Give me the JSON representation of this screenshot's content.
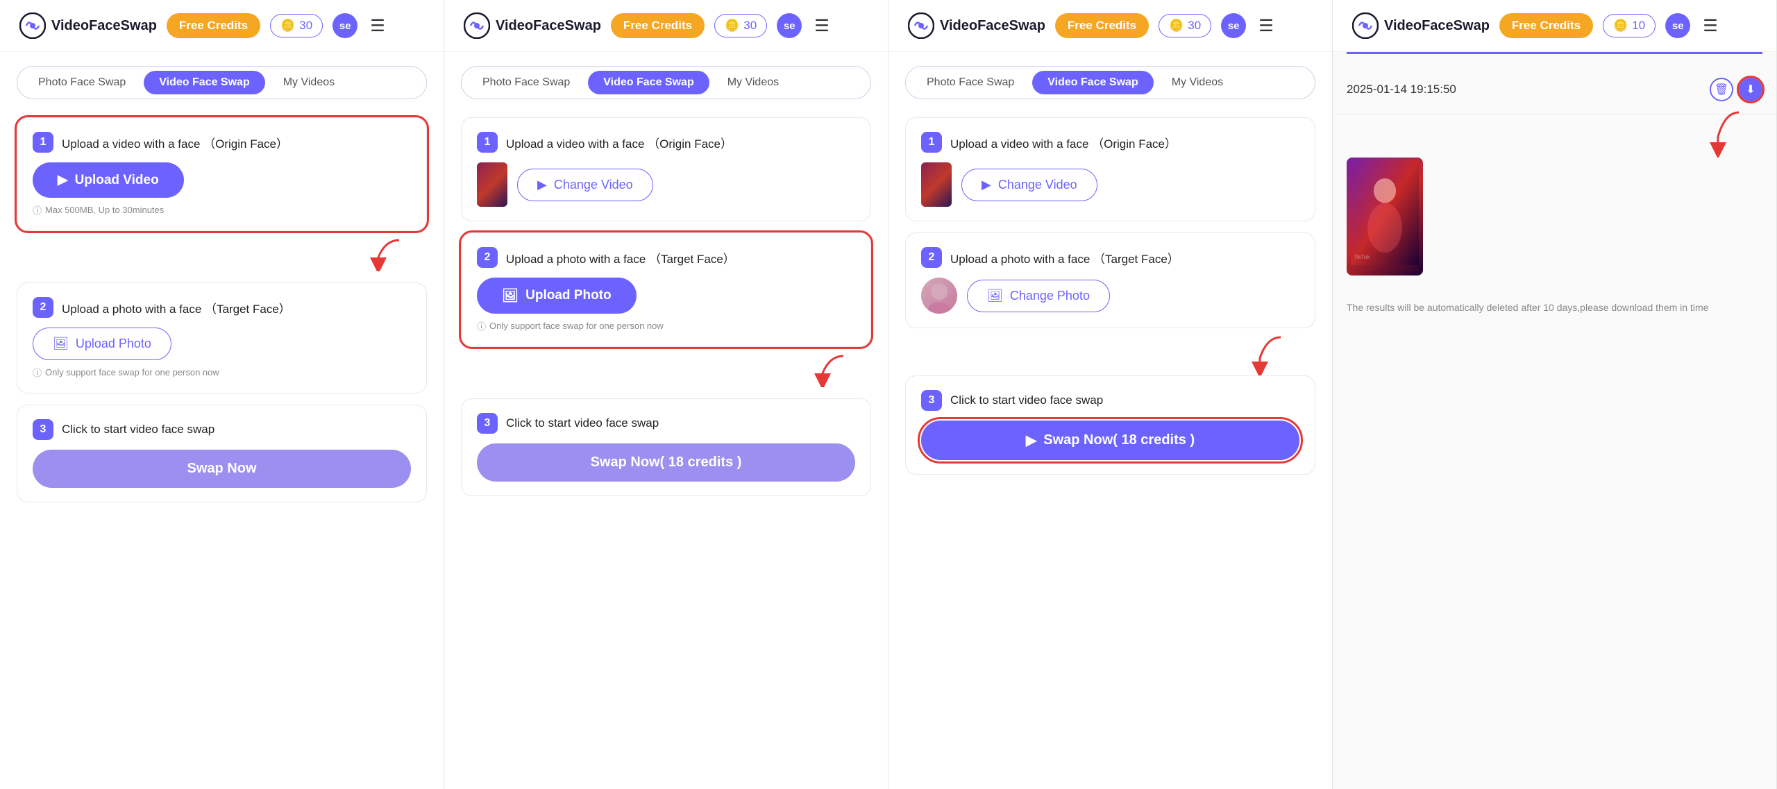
{
  "panels": [
    {
      "id": "panel1",
      "header": {
        "logo": "VideoFaceSwap",
        "free_credits_label": "Free Credits",
        "credits_count": "30",
        "avatar_label": "se"
      },
      "tabs": [
        "Photo Face Swap",
        "Video Face Swap",
        "My Videos"
      ],
      "active_tab": 1,
      "steps": [
        {
          "num": "1",
          "title": "Upload a video with a face  （Origin Face）",
          "button_label": "Upload Video",
          "hint": "Max 500MB, Up to 30minutes",
          "show_upload": true,
          "has_video": false,
          "highlight": true
        },
        {
          "num": "2",
          "title": "Upload a photo with a face  （Target Face）",
          "button_label": "Upload Photo",
          "hint": "Only support face swap for one person now",
          "show_upload": true,
          "has_photo": false,
          "highlight": false
        },
        {
          "num": "3",
          "title": "Click to start video face swap",
          "button_label": "Swap Now",
          "highlight": false
        }
      ],
      "arrow_pos": "step1"
    },
    {
      "id": "panel2",
      "header": {
        "logo": "VideoFaceSwap",
        "free_credits_label": "Free Credits",
        "credits_count": "30",
        "avatar_label": "se"
      },
      "tabs": [
        "Photo Face Swap",
        "Video Face Swap",
        "My Videos"
      ],
      "active_tab": 1,
      "steps": [
        {
          "num": "1",
          "title": "Upload a video with a face  （Origin Face）",
          "button_label": "Change Video",
          "hint": "",
          "show_upload": false,
          "has_video": true,
          "highlight": false
        },
        {
          "num": "2",
          "title": "Upload a photo with a face  （Target Face）",
          "button_label": "Upload Photo",
          "hint": "Only support face swap for one person now",
          "show_upload": true,
          "has_photo": false,
          "highlight": true
        },
        {
          "num": "3",
          "title": "Click to start video face swap",
          "button_label": "Swap Now( 18 credits )",
          "highlight": false
        }
      ],
      "arrow_pos": "step2"
    },
    {
      "id": "panel3",
      "header": {
        "logo": "VideoFaceSwap",
        "free_credits_label": "Free Credits",
        "credits_count": "30",
        "avatar_label": "se"
      },
      "tabs": [
        "Photo Face Swap",
        "Video Face Swap",
        "My Videos"
      ],
      "active_tab": 1,
      "steps": [
        {
          "num": "1",
          "title": "Upload a video with a face  （Origin Face）",
          "button_label": "Change Video",
          "hint": "",
          "show_upload": false,
          "has_video": true,
          "highlight": false
        },
        {
          "num": "2",
          "title": "Upload a photo with a face  （Target Face）",
          "button_label": "Change Photo",
          "hint": "",
          "show_upload": false,
          "has_photo": true,
          "highlight": false
        },
        {
          "num": "3",
          "title": "Click to start video face swap",
          "button_label": "Swap Now( 18 credits )",
          "highlight": true
        }
      ],
      "arrow_pos": "step3"
    },
    {
      "id": "panel4",
      "header": {
        "logo": "VideoFaceSwap",
        "free_credits_label": "Free Credits",
        "credits_count": "10",
        "avatar_label": "se"
      },
      "result": {
        "timestamp": "2025-01-14 19:15:50",
        "notice": "The results will be automatically deleted after 10 days,please download them in time"
      },
      "arrow_pos": "download"
    }
  ],
  "icons": {
    "play": "▶",
    "image": "🖼",
    "coin": "🪙",
    "menu": "☰",
    "info": "ⓘ",
    "delete": "🗑",
    "download": "⬇",
    "arrow_down": "↓"
  }
}
